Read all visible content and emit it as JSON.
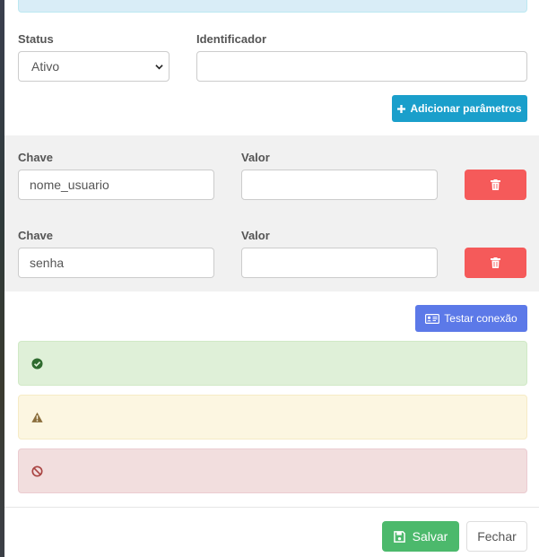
{
  "form": {
    "status_label": "Status",
    "status_value": "Ativo",
    "identifier_label": "Identificador",
    "identifier_value": "",
    "add_params_label": "Adicionar parâmetros"
  },
  "params": [
    {
      "key_label": "Chave",
      "key_value": "nome_usuario",
      "value_label": "Valor",
      "value_value": ""
    },
    {
      "key_label": "Chave",
      "key_value": "senha",
      "value_label": "Valor",
      "value_value": ""
    }
  ],
  "test_connection_label": "Testar conexão",
  "alerts": {
    "success_icon": "check-circle-icon",
    "warning_icon": "warning-triangle-icon",
    "danger_icon": "ban-icon"
  },
  "footer": {
    "save_label": "Salvar",
    "close_label": "Fechar"
  },
  "colors": {
    "info_button": "#1a9fcb",
    "danger_button": "#f55a5a",
    "test_button": "#5c79e8",
    "save_button": "#4cb96c"
  }
}
